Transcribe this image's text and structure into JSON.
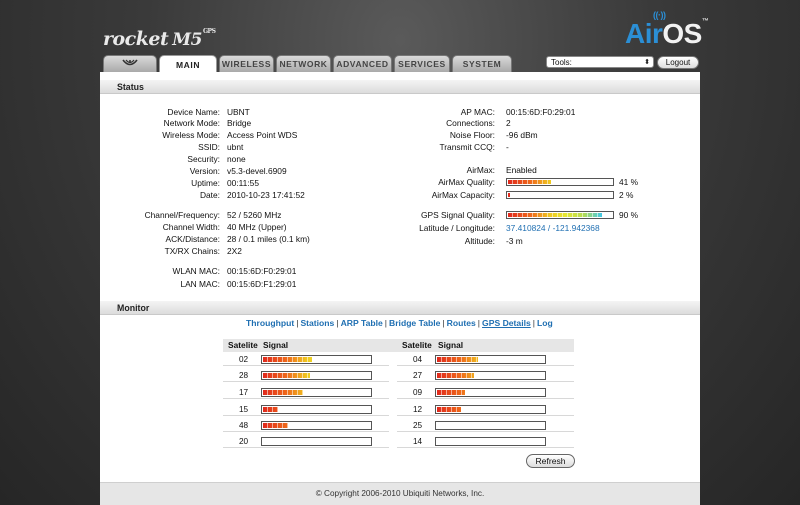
{
  "branding": {
    "product": "rocket",
    "model": "M5",
    "model_suffix": "GPS",
    "os_air": "Air",
    "os_os": "OS",
    "trademark": "™"
  },
  "tabs": [
    {
      "label": "MAIN"
    },
    {
      "label": "WIRELESS"
    },
    {
      "label": "NETWORK"
    },
    {
      "label": "ADVANCED"
    },
    {
      "label": "SERVICES"
    },
    {
      "label": "SYSTEM"
    }
  ],
  "tools": {
    "label": "Tools:",
    "arrow": "⬍"
  },
  "logout_label": "Logout",
  "status": {
    "title": "Status",
    "left": [
      {
        "label": "Device Name:",
        "value": "UBNT"
      },
      {
        "label": "Network Mode:",
        "value": "Bridge"
      },
      {
        "label": "Wireless Mode:",
        "value": "Access Point WDS"
      },
      {
        "label": "SSID:",
        "value": "ubnt"
      },
      {
        "label": "Security:",
        "value": "none"
      },
      {
        "label": "Version:",
        "value": "v5.3-devel.6909"
      },
      {
        "label": "Uptime:",
        "value": "00:11:55"
      },
      {
        "label": "Date:",
        "value": "2010-10-23 17:41:52"
      },
      {
        "label": "Channel/Frequency:",
        "value": "52 / 5260 MHz"
      },
      {
        "label": "Channel Width:",
        "value": "40 MHz (Upper)"
      },
      {
        "label": "ACK/Distance:",
        "value": "28 / 0.1 miles (0.1 km)"
      },
      {
        "label": "TX/RX Chains:",
        "value": "2X2"
      },
      {
        "label": "WLAN MAC:",
        "value": "00:15:6D:F0:29:01"
      },
      {
        "label": "LAN MAC:",
        "value": "00:15:6D:F1:29:01"
      }
    ],
    "right": {
      "ap_mac": {
        "label": "AP MAC:",
        "value": "00:15:6D:F0:29:01"
      },
      "connections": {
        "label": "Connections:",
        "value": "2"
      },
      "noise_floor": {
        "label": "Noise Floor:",
        "value": "-96 dBm"
      },
      "transmit_ccq": {
        "label": "Transmit CCQ:",
        "value": "-"
      },
      "airmax": {
        "label": "AirMax:",
        "value": "Enabled"
      },
      "airmax_quality": {
        "label": "AirMax Quality:",
        "value": "41 %",
        "fraction": 0.41
      },
      "airmax_capacity": {
        "label": "AirMax Capacity:",
        "value": "2 %",
        "fraction": 0.02
      },
      "gps_signal_quality": {
        "label": "GPS Signal Quality:",
        "value": "90 %",
        "fraction": 0.9
      },
      "lat_long": {
        "label": "Latitude / Longitude:",
        "value": "37.410824 / -121.942368"
      },
      "altitude": {
        "label": "Altitude:",
        "value": "-3 m"
      }
    }
  },
  "monitor": {
    "title": "Monitor",
    "links": [
      {
        "label": "Throughput",
        "active": false
      },
      {
        "label": "Stations",
        "active": false
      },
      {
        "label": "ARP Table",
        "active": false
      },
      {
        "label": "Bridge Table",
        "active": false
      },
      {
        "label": "Routes",
        "active": false
      },
      {
        "label": "GPS Details",
        "active": true
      },
      {
        "label": "Log",
        "active": false
      }
    ],
    "sep": "|",
    "table": {
      "col_satellite": "Satelite",
      "col_signal": "Signal",
      "left": [
        {
          "sat": "02",
          "signal": 0.45
        },
        {
          "sat": "28",
          "signal": 0.43
        },
        {
          "sat": "17",
          "signal": 0.37
        },
        {
          "sat": "15",
          "signal": 0.14
        },
        {
          "sat": "48",
          "signal": 0.23
        },
        {
          "sat": "20",
          "signal": 0.0
        }
      ],
      "right": [
        {
          "sat": "04",
          "signal": 0.38
        },
        {
          "sat": "27",
          "signal": 0.34
        },
        {
          "sat": "09",
          "signal": 0.26
        },
        {
          "sat": "12",
          "signal": 0.22
        },
        {
          "sat": "25",
          "signal": 0.0
        },
        {
          "sat": "14",
          "signal": 0.0
        }
      ]
    },
    "refresh_label": "Refresh"
  },
  "footer": "© Copyright 2006-2010 Ubiquiti Networks, Inc.",
  "colors": {
    "link": "#1f6fb2",
    "airos_blue": "#2b8fd6",
    "signal_red": "#e0281c",
    "signal_yellow": "#f0e020",
    "signal_cyan": "#40c8e8"
  }
}
